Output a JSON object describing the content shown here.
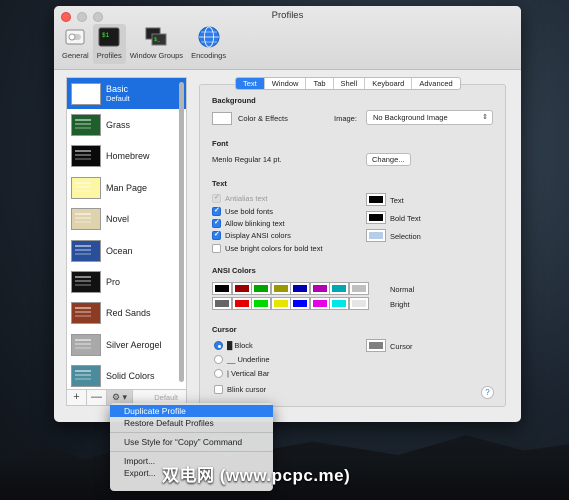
{
  "window": {
    "title": "Profiles"
  },
  "toolbar": [
    {
      "label": "General",
      "icon": "switch-icon"
    },
    {
      "label": "Profiles",
      "icon": "terminal-icon",
      "active": true
    },
    {
      "label": "Window Groups",
      "icon": "window-groups-icon"
    },
    {
      "label": "Encodings",
      "icon": "globe-icon"
    }
  ],
  "profiles": [
    {
      "name": "Basic",
      "sub": "Default",
      "thumb": "#ffffff"
    },
    {
      "name": "Grass",
      "thumb": "#1f5f2c"
    },
    {
      "name": "Homebrew",
      "thumb": "#0a0a0a"
    },
    {
      "name": "Man Page",
      "thumb": "#fdf6a3"
    },
    {
      "name": "Novel",
      "thumb": "#dfd3ae"
    },
    {
      "name": "Ocean",
      "thumb": "#2a4f9a"
    },
    {
      "name": "Pro",
      "thumb": "#111111"
    },
    {
      "name": "Red Sands",
      "thumb": "#8e3b24"
    },
    {
      "name": "Silver Aerogel",
      "thumb": "#a9a9a9"
    },
    {
      "name": "Solid Colors",
      "thumb": "#4a8b9d"
    }
  ],
  "sidebar_controls": {
    "add": "+",
    "remove": "—",
    "gear": "⚙ ▾",
    "default": "Default"
  },
  "tabs": [
    "Text",
    "Window",
    "Tab",
    "Shell",
    "Keyboard",
    "Advanced"
  ],
  "background": {
    "heading": "Background",
    "color_effects": "Color & Effects",
    "image_label": "Image:",
    "image_value": "No Background Image"
  },
  "font": {
    "heading": "Font",
    "value": "Menlo Regular 14 pt.",
    "change_button": "Change..."
  },
  "text": {
    "heading": "Text",
    "options": [
      {
        "label": "Antialias text",
        "checked": true,
        "disabled": true
      },
      {
        "label": "Use bold fonts",
        "checked": true
      },
      {
        "label": "Allow blinking text",
        "checked": true
      },
      {
        "label": "Display ANSI colors",
        "checked": true
      },
      {
        "label": "Use bright colors for bold text",
        "checked": false
      }
    ],
    "color_labels": [
      "Text",
      "Bold Text",
      "Selection"
    ],
    "colors": [
      "#000000",
      "#000000",
      "#b5cde6"
    ]
  },
  "ansi": {
    "heading": "ANSI Colors",
    "normal_label": "Normal",
    "bright_label": "Bright",
    "normal": [
      "#000000",
      "#990000",
      "#00a600",
      "#999900",
      "#0000b2",
      "#b200b2",
      "#00a6b2",
      "#bfbfbf"
    ],
    "bright": [
      "#666666",
      "#e50000",
      "#00d900",
      "#e5e500",
      "#0000ff",
      "#e500e5",
      "#00e5e5",
      "#e5e5e5"
    ]
  },
  "cursor": {
    "heading": "Cursor",
    "options": [
      {
        "label": "Block",
        "glyph": "█",
        "selected": true
      },
      {
        "label": "Underline",
        "glyph": "__"
      },
      {
        "label": "Vertical Bar",
        "glyph": "|"
      }
    ],
    "blink_label": "Blink cursor",
    "color_label": "Cursor",
    "color": "#7f7f7f"
  },
  "help": "?",
  "context_menu": {
    "items": [
      "Duplicate Profile",
      "Restore Default Profiles",
      "Use Style for “Copy” Command",
      "Import...",
      "Export..."
    ],
    "highlighted": 0
  },
  "watermark": "双电网 (www.pcpc.me)"
}
